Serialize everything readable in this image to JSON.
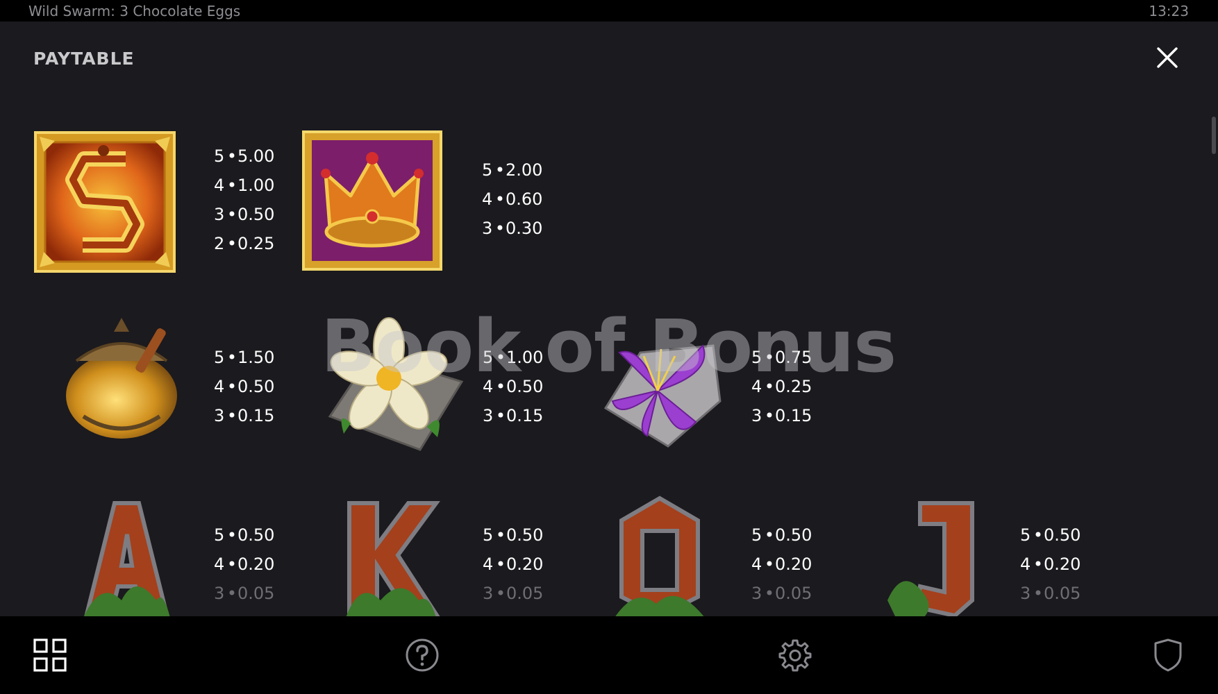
{
  "window": {
    "title": "Wild Swarm: 3 Chocolate Eggs",
    "clock": "13:23"
  },
  "header": {
    "title": "PAYTABLE"
  },
  "watermark": "Book of Bonus",
  "symbols": [
    {
      "name": "scatter-s",
      "pays": [
        {
          "count": "5",
          "value": "5.00"
        },
        {
          "count": "4",
          "value": "1.00"
        },
        {
          "count": "3",
          "value": "0.50"
        },
        {
          "count": "2",
          "value": "0.25"
        }
      ]
    },
    {
      "name": "crown",
      "pays": [
        {
          "count": "5",
          "value": "2.00"
        },
        {
          "count": "4",
          "value": "0.60"
        },
        {
          "count": "3",
          "value": "0.30"
        }
      ]
    },
    {
      "name": "honey-pot",
      "pays": [
        {
          "count": "5",
          "value": "1.50"
        },
        {
          "count": "4",
          "value": "0.50"
        },
        {
          "count": "3",
          "value": "0.15"
        }
      ]
    },
    {
      "name": "white-flower",
      "pays": [
        {
          "count": "5",
          "value": "1.00"
        },
        {
          "count": "4",
          "value": "0.50"
        },
        {
          "count": "3",
          "value": "0.15"
        }
      ]
    },
    {
      "name": "purple-flower",
      "pays": [
        {
          "count": "5",
          "value": "0.75"
        },
        {
          "count": "4",
          "value": "0.25"
        },
        {
          "count": "3",
          "value": "0.15"
        }
      ]
    },
    {
      "name": "letter-a",
      "pays": [
        {
          "count": "5",
          "value": "0.50"
        },
        {
          "count": "4",
          "value": "0.20"
        },
        {
          "count": "3",
          "value": "0.05"
        }
      ]
    },
    {
      "name": "letter-k",
      "pays": [
        {
          "count": "5",
          "value": "0.50"
        },
        {
          "count": "4",
          "value": "0.20"
        },
        {
          "count": "3",
          "value": "0.05"
        }
      ]
    },
    {
      "name": "letter-q",
      "pays": [
        {
          "count": "5",
          "value": "0.50"
        },
        {
          "count": "4",
          "value": "0.20"
        },
        {
          "count": "3",
          "value": "0.05"
        }
      ]
    },
    {
      "name": "letter-j",
      "pays": [
        {
          "count": "5",
          "value": "0.50"
        },
        {
          "count": "4",
          "value": "0.20"
        },
        {
          "count": "3",
          "value": "0.05"
        }
      ]
    }
  ],
  "bottom_nav": {
    "icons": [
      "grid-icon",
      "help-icon",
      "gear-icon",
      "shield-icon"
    ]
  },
  "colors": {
    "background": "#1b1a1e",
    "bar": "#000000",
    "text": "#ffffff",
    "muted": "#6f6e74"
  }
}
